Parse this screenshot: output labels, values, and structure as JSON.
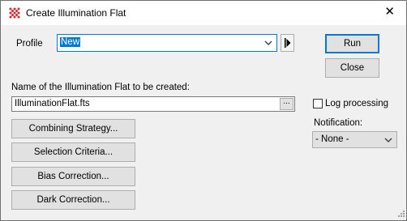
{
  "window": {
    "title": "Create Illumination Flat",
    "icon": "red-dot-grid-icon",
    "close_glyph": "✕"
  },
  "profile": {
    "label": "Profile",
    "value": "New",
    "play_glyph": "▶"
  },
  "actions": {
    "run_label": "Run",
    "close_label": "Close"
  },
  "output": {
    "label": "Name of the Illumination Flat to be created:",
    "filename": "IlluminationFlat.fts",
    "browse_label": "..."
  },
  "options": {
    "log_processing_label": "Log processing",
    "log_processing_checked": false,
    "notification_label": "Notification:",
    "notification_value": "- None -"
  },
  "settings_buttons": {
    "combining_strategy": "Combining Strategy...",
    "selection_criteria": "Selection Criteria...",
    "bias_correction": "Bias Correction...",
    "dark_correction": "Dark Correction..."
  },
  "colors": {
    "accent": "#0078d7",
    "icon_red": "#d9262b",
    "window_bg": "#f0f0f0"
  }
}
